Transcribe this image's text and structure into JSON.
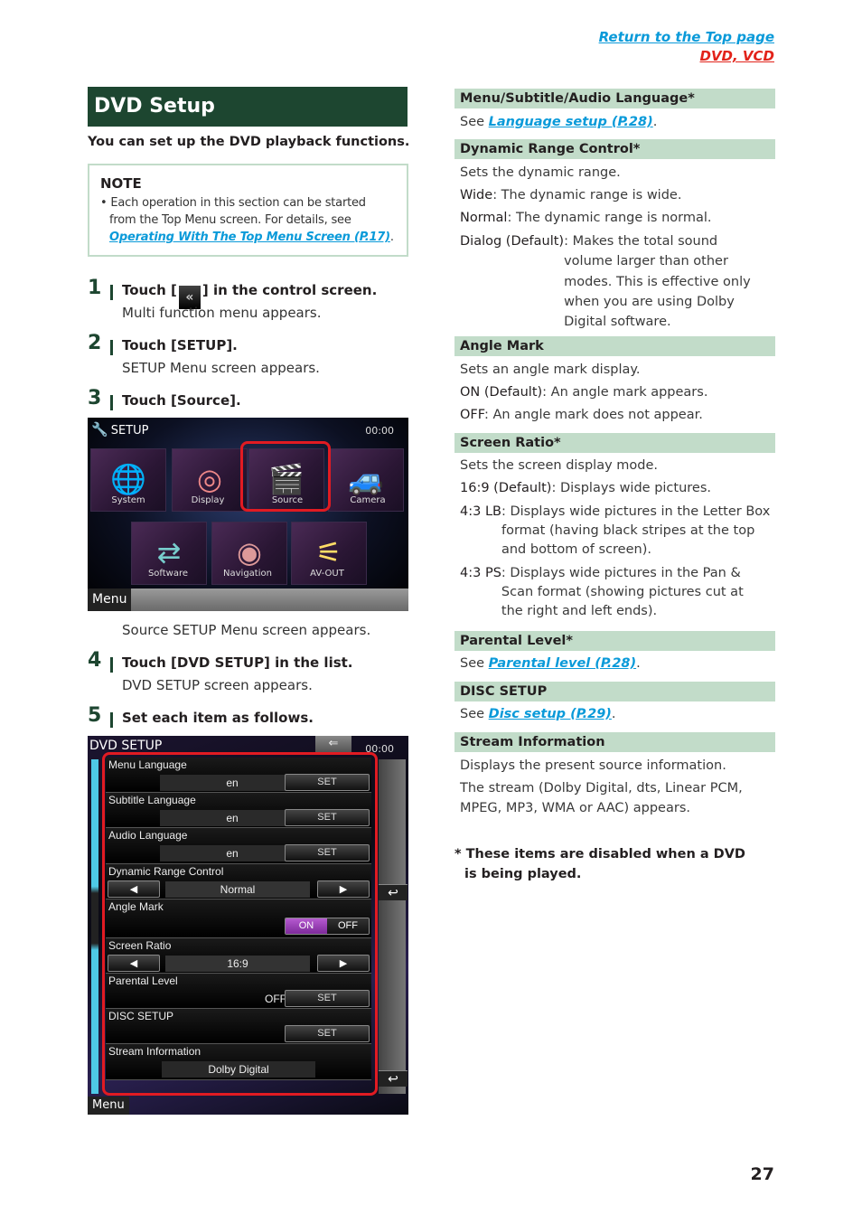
{
  "nav": {
    "return_top": "Return to the Top page",
    "section_link": "DVD, VCD"
  },
  "title": "DVD Setup",
  "intro": "You can set up the DVD playback functions.",
  "note": {
    "title": "NOTE",
    "bullet": "•",
    "text_before": "Each operation in this section can be started from the Top Menu screen. For details, see ",
    "link": "Operating With The Top Menu Screen (P.17)",
    "text_after": "."
  },
  "steps": [
    {
      "num": "1",
      "head_before": "Touch [",
      "icon": "«",
      "head_after": "] in the control screen.",
      "sub": "Multi function menu appears."
    },
    {
      "num": "2",
      "head": "Touch [SETUP].",
      "sub": "SETUP Menu screen appears."
    },
    {
      "num": "3",
      "head": "Touch [Source].",
      "sub": "Source SETUP Menu screen appears."
    },
    {
      "num": "4",
      "head": "Touch [DVD SETUP] in the list.",
      "sub": "DVD SETUP screen appears."
    },
    {
      "num": "5",
      "head": "Set each item as follows."
    }
  ],
  "setup_screen": {
    "title": "SETUP",
    "clock": "00:00",
    "tiles": [
      "System",
      "Display",
      "Source",
      "Camera",
      "Software",
      "Navigation",
      "AV-OUT"
    ],
    "menu": "Menu"
  },
  "dvd_screen": {
    "title": "DVD SETUP",
    "clock": "00:00",
    "back": "⇐",
    "return": "↩",
    "menu": "Menu",
    "set": "SET",
    "on": "ON",
    "off": "OFF",
    "left_arrow": "◀",
    "right_arrow": "▶",
    "rows": [
      {
        "label": "Menu Language",
        "value": "en"
      },
      {
        "label": "Subtitle Language",
        "value": "en"
      },
      {
        "label": "Audio Language",
        "value": "en"
      },
      {
        "label": "Dynamic Range Control",
        "value": "Normal"
      },
      {
        "label": "Angle Mark",
        "value": "ON"
      },
      {
        "label": "Screen Ratio",
        "value": "16:9"
      },
      {
        "label": "Parental Level",
        "value": "OFF"
      },
      {
        "label": "DISC SETUP",
        "value": ""
      },
      {
        "label": "Stream Information",
        "value": "Dolby Digital"
      }
    ]
  },
  "sections": {
    "lang": {
      "head": "Menu/Subtitle/Audio Language*",
      "see": "See ",
      "link": "Language setup (P.28)",
      "end": "."
    },
    "drc": {
      "head": "Dynamic Range Control*",
      "desc": "Sets the dynamic range.",
      "wide_term": "Wide",
      "wide_def": ": The dynamic range is wide.",
      "normal_term": "Normal",
      "normal_def": ": The dynamic range is normal.",
      "dialog_term": "Dialog (Default)",
      "dialog_def": ": Makes the total sound volume larger than other modes. This is effective only when you are using Dolby Digital software."
    },
    "angle": {
      "head": "Angle Mark",
      "desc": "Sets an angle mark display.",
      "on_term": "ON (Default)",
      "on_def": ": An angle mark appears.",
      "off_term": "OFF",
      "off_def": ": An angle mark does not appear."
    },
    "ratio": {
      "head": "Screen Ratio*",
      "desc": "Sets the screen display mode.",
      "r169_term": "16:9 (Default)",
      "r169_def": ": Displays wide pictures.",
      "lb_term": "4:3 LB",
      "lb_def": ": Displays wide pictures in the Letter Box format (having black stripes at the top and bottom of screen).",
      "ps_term": "4:3 PS",
      "ps_def": ": Displays wide pictures in the Pan & Scan format (showing pictures cut at the right and left ends)."
    },
    "parental": {
      "head": "Parental Level*",
      "see": "See ",
      "link": "Parental level (P.28)",
      "end": "."
    },
    "disc": {
      "head": "DISC SETUP",
      "see": "See ",
      "link": "Disc setup (P.29)",
      "end": "."
    },
    "stream": {
      "head": "Stream Information",
      "desc": "Displays the present source information.",
      "desc2": "The stream (Dolby Digital, dts, Linear PCM,",
      "desc3": "MPEG, MP3, WMA or AAC) appears."
    }
  },
  "footnote": "* These items are disabled when a DVD is being played.",
  "page_number": "27"
}
